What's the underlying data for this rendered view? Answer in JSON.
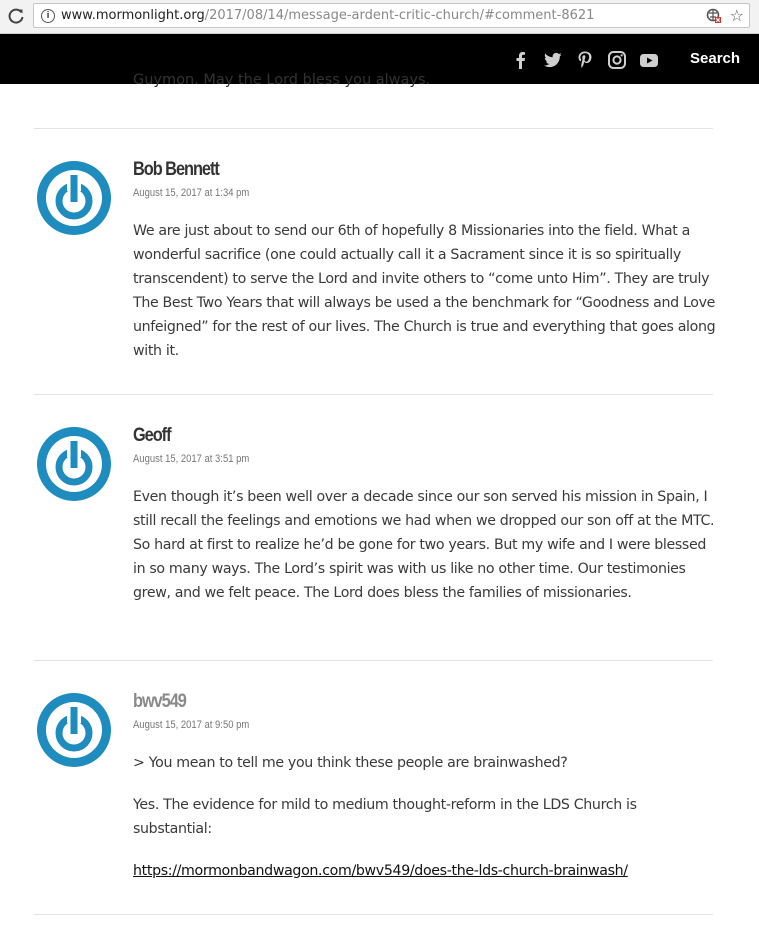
{
  "browser": {
    "url_host": "www.mormonlight.org",
    "url_path": "/2017/08/14/message-ardent-critic-church/#comment-8621"
  },
  "site": {
    "social_icons": [
      "facebook-icon",
      "twitter-icon",
      "pinterest-icon",
      "instagram-icon",
      "youtube-icon"
    ],
    "search_label": "Search"
  },
  "partial_comment": {
    "text": "Guymon. May the Lord bless you always."
  },
  "comments": [
    {
      "author": "Bob Bennett",
      "date": "August 15, 2017 at 1:34 pm",
      "paragraphs": [
        "We are just about to send our 6th of hopefully 8 Missionaries into the field. What a wonderful sacrifice (one could actually call it a Sacrament since it is so spiritually transcendent) to serve the Lord and invite others to “come unto Him”. They are truly The Best Two Years that will always be used a the benchmark for “Goodness and Love unfeigned” for the rest of our lives. The Church is true and everything that goes along with it."
      ]
    },
    {
      "author": "Geoff",
      "date": "August 15, 2017 at 3:51 pm",
      "paragraphs": [
        "Even though it’s been well over a decade since our son served his mission in Spain, I still recall the feelings and emotions we had when we dropped our son off at the MTC. So hard at first to realize he’d be gone for two years. But my wife and I were blessed in so many ways. The Lord’s spirit was with us like no other time. Our testimonies grew, and we felt peace. The Lord does bless the families of missionaries."
      ]
    },
    {
      "author": "bwv549",
      "date": "August 15, 2017 at 9:50 pm",
      "paragraphs": [
        "> You mean to tell me you think these people are brainwashed?",
        "Yes. The evidence for mild to medium thought-reform in the LDS Church is substantial:"
      ],
      "link": "https://mormonbandwagon.com/bwv549/does-the-lds-church-brainwash/"
    }
  ],
  "colors": {
    "avatar_blue": "#1e8cbe",
    "header_bg": "#000000"
  }
}
